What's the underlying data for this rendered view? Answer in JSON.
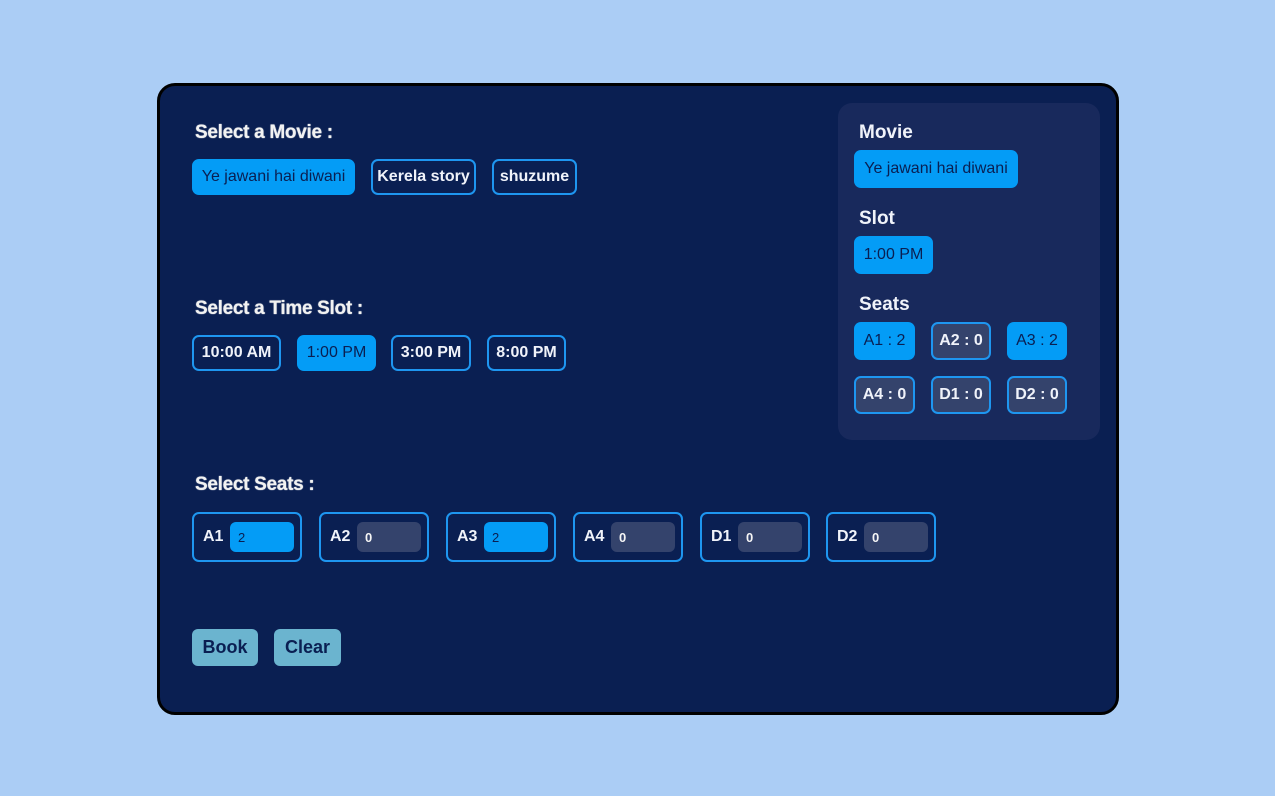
{
  "movie_section": {
    "title": "Select a Movie :",
    "options": [
      "Ye jawani hai diwani",
      "Kerela story",
      "shuzume"
    ],
    "selected": "Ye jawani hai diwani"
  },
  "slot_section": {
    "title": "Select a Time Slot :",
    "options": [
      "10:00 AM",
      "1:00 PM",
      "3:00 PM",
      "8:00 PM"
    ],
    "selected": "1:00 PM"
  },
  "seat_section": {
    "title": "Select Seats :",
    "seats": [
      {
        "label": "A1",
        "value": "2"
      },
      {
        "label": "A2",
        "value": "0"
      },
      {
        "label": "A3",
        "value": "2"
      },
      {
        "label": "A4",
        "value": "0"
      },
      {
        "label": "D1",
        "value": "0"
      },
      {
        "label": "D2",
        "value": "0"
      }
    ]
  },
  "actions": {
    "book_label": "Book",
    "clear_label": "Clear"
  },
  "summary": {
    "movie_heading": "Movie",
    "movie_value": "Ye jawani hai diwani",
    "slot_heading": "Slot",
    "slot_value": "1:00 PM",
    "seats_heading": "Seats",
    "seats": [
      "A1 : 2",
      "A2 : 0",
      "A3 : 2",
      "A4 : 0",
      "D1 : 0",
      "D2 : 0"
    ]
  },
  "colors": {
    "page_background": "#abcdf5",
    "card_background": "#0a1f52",
    "accent": "#049cf6",
    "button": "#6bb4cf"
  }
}
